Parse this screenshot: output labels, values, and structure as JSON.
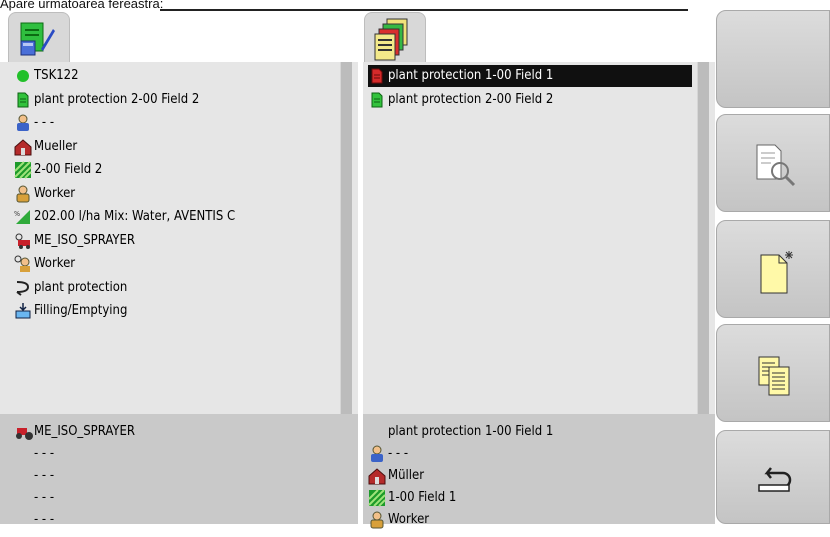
{
  "caption": "Apare următoarea fereastră:",
  "left_list": [
    {
      "icon": "green-dot-icon",
      "label": "TSK122"
    },
    {
      "icon": "green-document-icon",
      "label": "plant protection 2-00 Field 2"
    },
    {
      "icon": "customer-icon",
      "label": "- - -"
    },
    {
      "icon": "farm-icon",
      "label": "Mueller"
    },
    {
      "icon": "field-icon",
      "label": "2-00 Field 2"
    },
    {
      "icon": "worker-icon",
      "label": "Worker"
    },
    {
      "icon": "product-icon",
      "label": "202.00 l/ha Mix: Water, AVENTIS C"
    },
    {
      "icon": "machine-icon",
      "label": "ME_ISO_SPRAYER"
    },
    {
      "icon": "operator-icon",
      "label": "Worker"
    },
    {
      "icon": "operation-icon",
      "label": "plant protection"
    },
    {
      "icon": "filling-icon",
      "label": "Filling/Emptying"
    }
  ],
  "left_lower": [
    {
      "icon": "tractor-icon",
      "label": "ME_ISO_SPRAYER"
    },
    {
      "label": "- - -"
    },
    {
      "label": "- - -"
    },
    {
      "label": "- - -"
    },
    {
      "label": "- - -"
    }
  ],
  "right_list": [
    {
      "icon": "red-document-icon",
      "label": "plant protection 1-00 Field 1",
      "selected": true
    },
    {
      "icon": "green-document-icon",
      "label": "plant protection 2-00 Field 2",
      "selected": false
    }
  ],
  "right_lower": [
    {
      "label": "plant protection 1-00 Field 1"
    },
    {
      "icon": "customer-icon",
      "label": "- - -"
    },
    {
      "icon": "farm-icon",
      "label": "Müller"
    },
    {
      "icon": "field-icon",
      "label": "1-00 Field 1"
    },
    {
      "icon": "worker-icon",
      "label": "Worker"
    }
  ],
  "softkeys": [
    {
      "name": "empty-softkey"
    },
    {
      "name": "preview-softkey",
      "icon": "document-magnifier-icon"
    },
    {
      "name": "new-task-softkey",
      "icon": "new-document-icon"
    },
    {
      "name": "copy-task-softkey",
      "icon": "copy-documents-icon"
    },
    {
      "name": "back-softkey",
      "icon": "return-arrow-icon"
    }
  ],
  "colors": {
    "selected_bg": "#101010",
    "pane_bg": "#e6e6e6",
    "lower_bg": "#c9c9c9",
    "softkey_bg": "#d0d0d0"
  }
}
